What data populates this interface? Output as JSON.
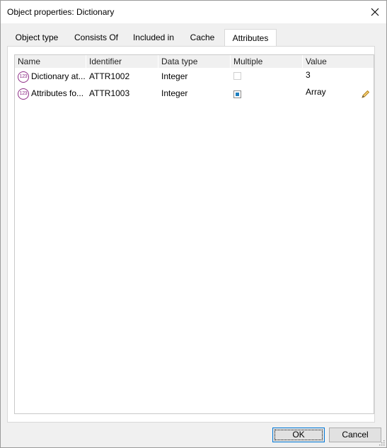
{
  "window": {
    "title": "Object properties: Dictionary"
  },
  "tabs": [
    {
      "label": "Object type",
      "active": false
    },
    {
      "label": "Consists Of",
      "active": false
    },
    {
      "label": "Included in",
      "active": false
    },
    {
      "label": "Cache",
      "active": false
    },
    {
      "label": "Attributes",
      "active": true
    }
  ],
  "grid": {
    "columns": [
      "Name",
      "Identifier",
      "Data type",
      "Multiple",
      "Value"
    ],
    "rows": [
      {
        "icon": "number-attribute-icon",
        "icon_text": "123",
        "name": "Dictionary at...",
        "identifier": "ATTR1002",
        "data_type": "Integer",
        "multiple": false,
        "value": "3"
      },
      {
        "icon": "number-attribute-icon",
        "icon_text": "123",
        "name": "Attributes fo...",
        "identifier": "ATTR1003",
        "data_type": "Integer",
        "multiple": true,
        "value": "Array",
        "value_icon": "pencil-icon"
      }
    ]
  },
  "buttons": {
    "ok": "OK",
    "cancel": "Cancel"
  },
  "colors": {
    "accent": "#0078d7",
    "icon_purple": "#8e2e87",
    "check_blue": "#1e7fbf"
  }
}
